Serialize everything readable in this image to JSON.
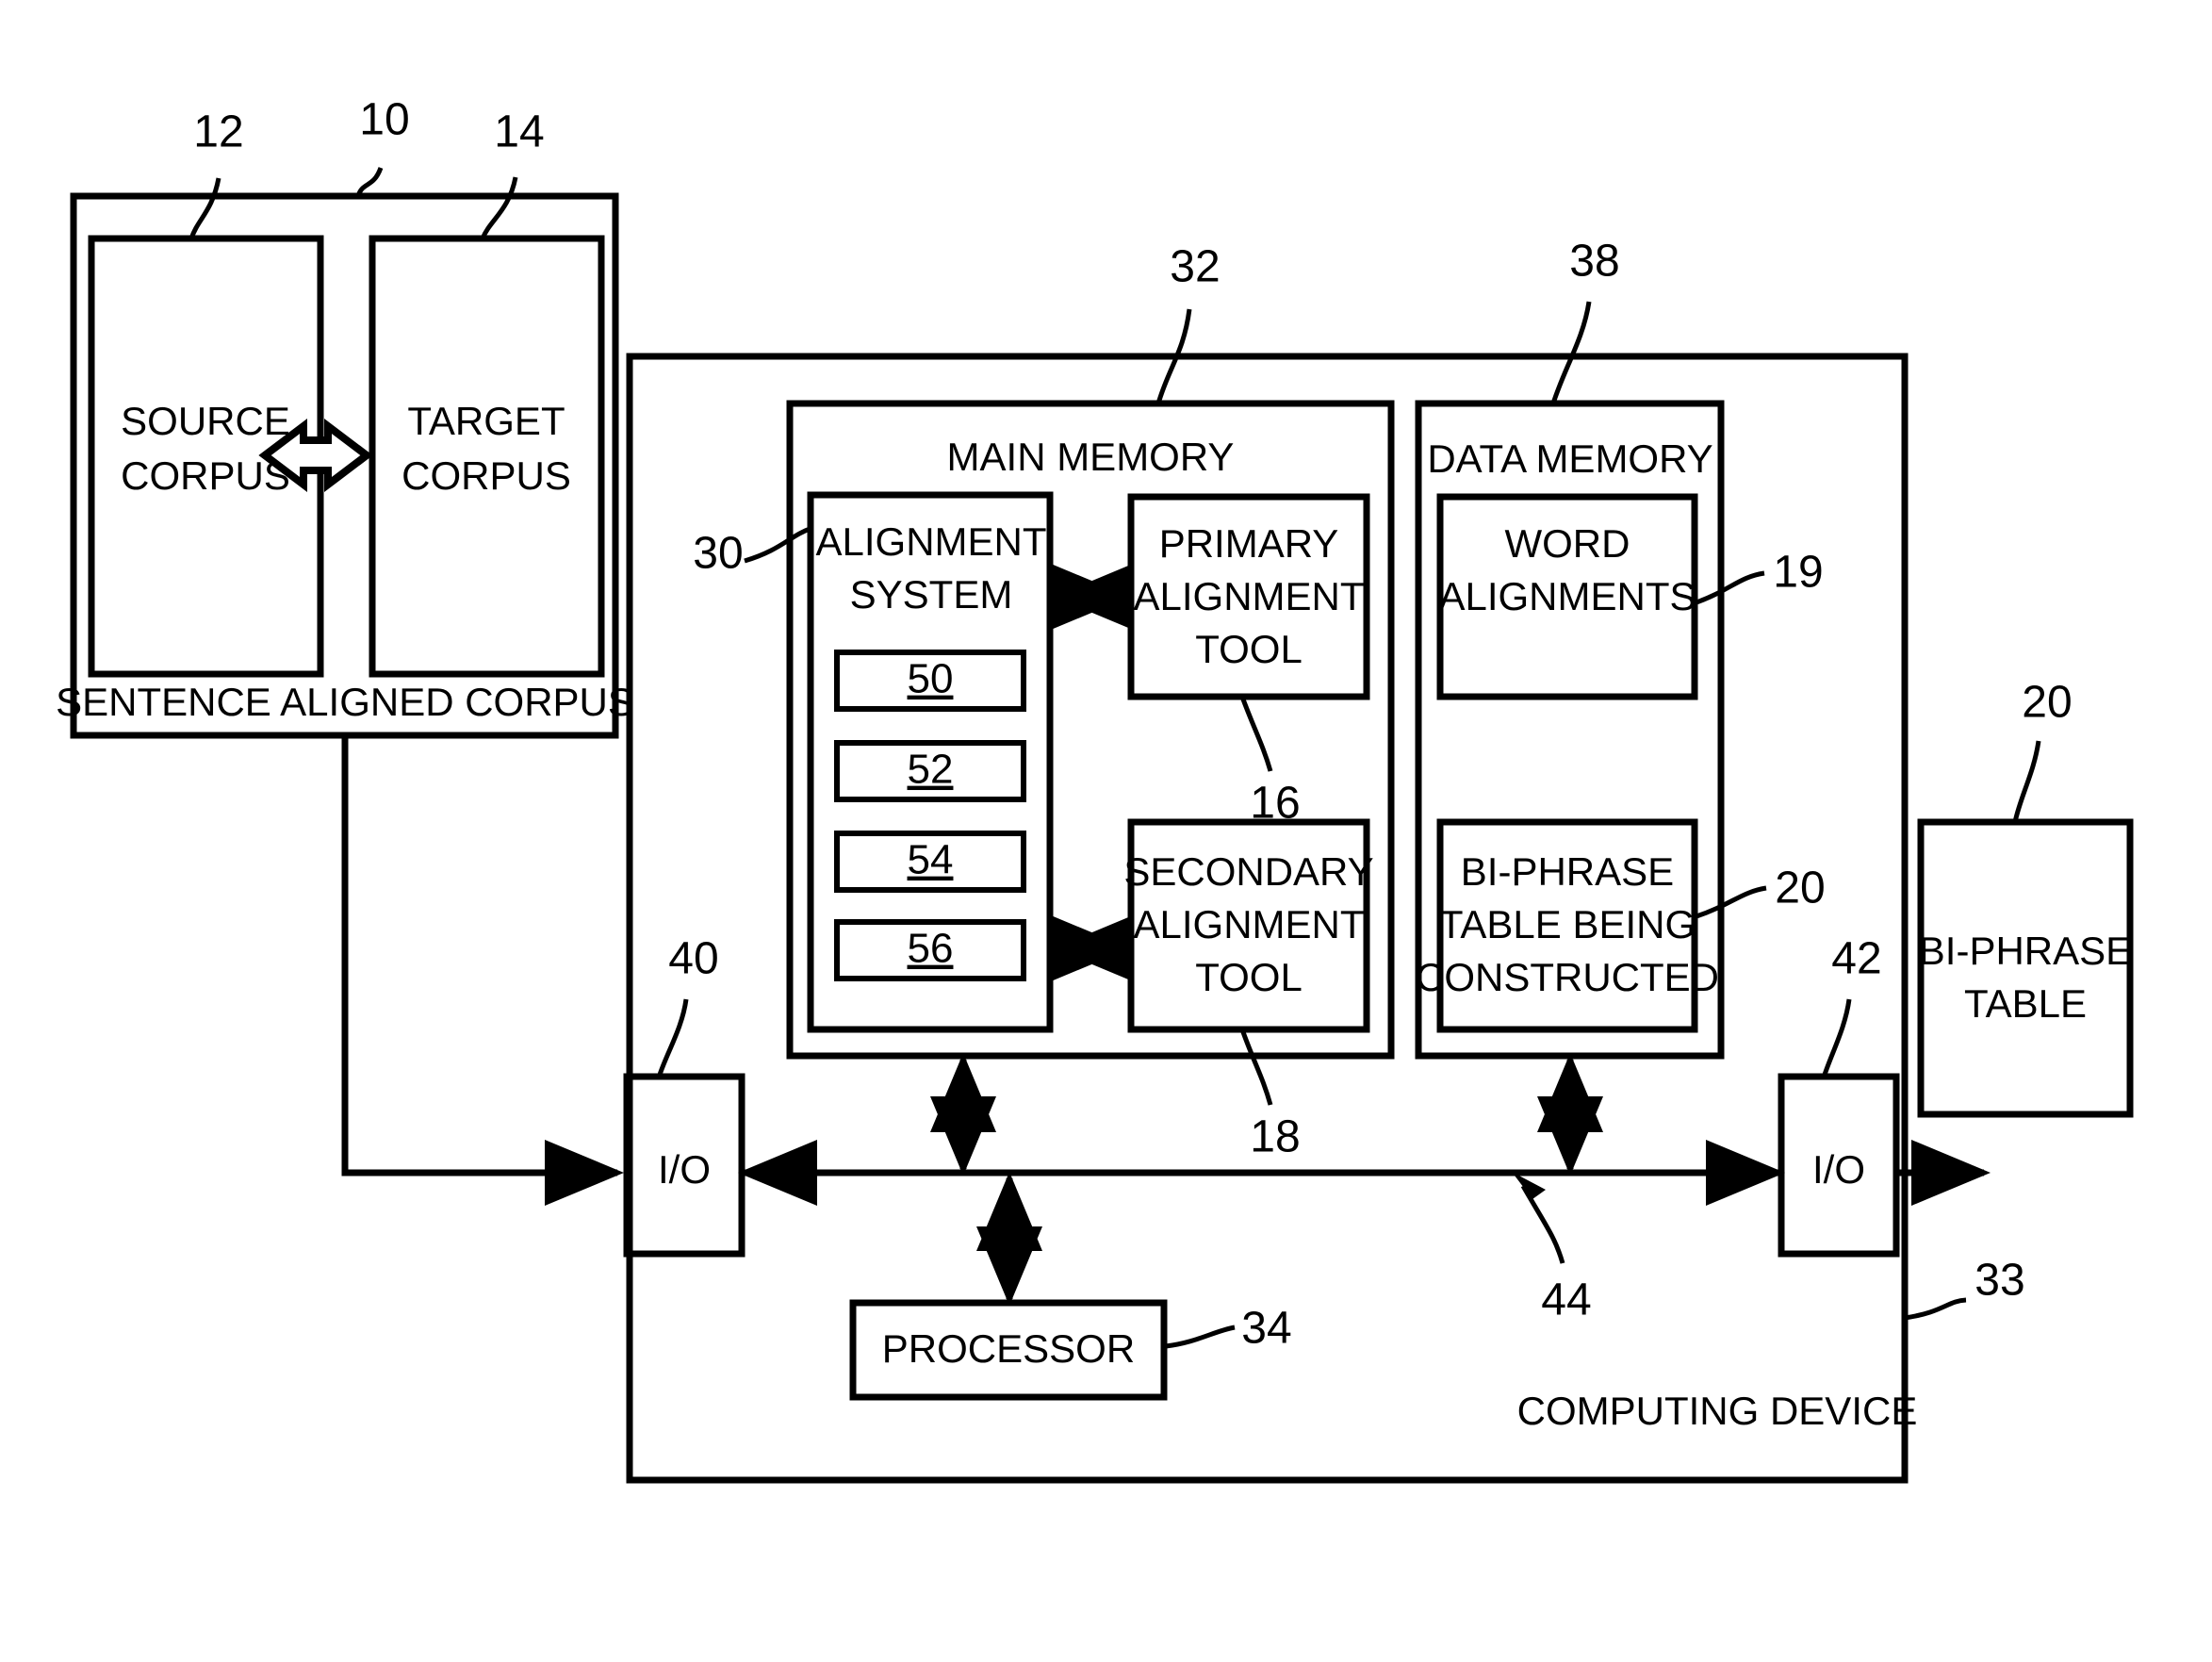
{
  "figure": {
    "type": "patent-block-diagram",
    "corpus_group": {
      "outer_label": "SENTENCE ALIGNED CORPUS",
      "outer_ref": "10",
      "source": {
        "label_line1": "SOURCE",
        "label_line2": "CORPUS",
        "ref": "12"
      },
      "target": {
        "label_line1": "TARGET",
        "label_line2": "CORPUS",
        "ref": "14"
      },
      "exchange_icon": "double-headed-arrow-icon"
    },
    "computing_device": {
      "label": "COMPUTING DEVICE",
      "ref": "33",
      "bus_ref": "44",
      "io_left": {
        "label": "I/O",
        "ref": "40"
      },
      "io_right": {
        "label": "I/O",
        "ref": "42"
      },
      "processor": {
        "label": "PROCESSOR",
        "ref": "34"
      },
      "main_memory": {
        "label": "MAIN MEMORY",
        "ref": "32",
        "alignment_system": {
          "label_line1": "ALIGNMENT",
          "label_line2": "SYSTEM",
          "ref": "30",
          "components": [
            "50",
            "52",
            "54",
            "56"
          ]
        },
        "primary_tool": {
          "label_line1": "PRIMARY",
          "label_line2": "ALIGNMENT",
          "label_line3": "TOOL",
          "ref": "16"
        },
        "secondary_tool": {
          "label_line1": "SECONDARY",
          "label_line2": "ALIGNMENT",
          "label_line3": "TOOL",
          "ref": "18"
        }
      },
      "data_memory": {
        "label": "DATA MEMORY",
        "ref": "38",
        "word_alignments": {
          "label_line1": "WORD",
          "label_line2": "ALIGNMENTS",
          "ref": "19"
        },
        "biphrase_constructed": {
          "label_line1": "BI-PHRASE",
          "label_line2": "TABLE BEING",
          "label_line3": "CONSTRUCTED",
          "ref": "20"
        }
      }
    },
    "biphrase_table": {
      "label_line1": "BI-PHRASE",
      "label_line2": "TABLE",
      "ref": "20"
    }
  },
  "colors": {
    "stroke": "#000000",
    "background": "#ffffff"
  }
}
